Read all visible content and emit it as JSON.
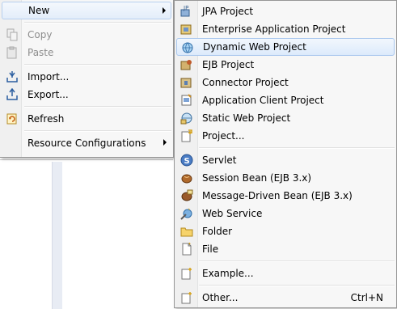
{
  "main_menu": {
    "items": [
      {
        "label": "New",
        "icon": "none",
        "submenu": true
      },
      {
        "label": "Copy",
        "icon": "copy-icon",
        "disabled": true
      },
      {
        "label": "Paste",
        "icon": "paste-icon",
        "disabled": true
      },
      {
        "label": "Import...",
        "icon": "import-icon"
      },
      {
        "label": "Export...",
        "icon": "export-icon"
      },
      {
        "label": "Refresh",
        "icon": "refresh-icon"
      },
      {
        "label": "Resource Configurations",
        "icon": "none",
        "submenu": true
      }
    ]
  },
  "sub_menu": {
    "items": [
      {
        "label": "JPA Project",
        "icon": "jpa-project-icon"
      },
      {
        "label": "Enterprise Application Project",
        "icon": "enterprise-project-icon"
      },
      {
        "label": "Dynamic Web Project",
        "icon": "dynamic-web-project-icon"
      },
      {
        "label": "EJB Project",
        "icon": "ejb-project-icon"
      },
      {
        "label": "Connector Project",
        "icon": "connector-project-icon"
      },
      {
        "label": "Application Client Project",
        "icon": "app-client-project-icon"
      },
      {
        "label": "Static Web Project",
        "icon": "static-web-project-icon"
      },
      {
        "label": "Project...",
        "icon": "project-icon"
      },
      {
        "label": "Servlet",
        "icon": "servlet-icon"
      },
      {
        "label": "Session Bean (EJB 3.x)",
        "icon": "session-bean-icon"
      },
      {
        "label": "Message-Driven Bean (EJB 3.x)",
        "icon": "message-bean-icon"
      },
      {
        "label": "Web Service",
        "icon": "web-service-icon"
      },
      {
        "label": "Folder",
        "icon": "folder-icon"
      },
      {
        "label": "File",
        "icon": "file-icon"
      },
      {
        "label": "Example...",
        "icon": "example-icon"
      },
      {
        "label": "Other...",
        "icon": "other-icon",
        "accelerator": "Ctrl+N"
      }
    ]
  },
  "colors": {
    "highlight_border": "#a9c7ee",
    "highlight_fill": "#dceafb",
    "disabled_text": "#8d8d8d"
  }
}
